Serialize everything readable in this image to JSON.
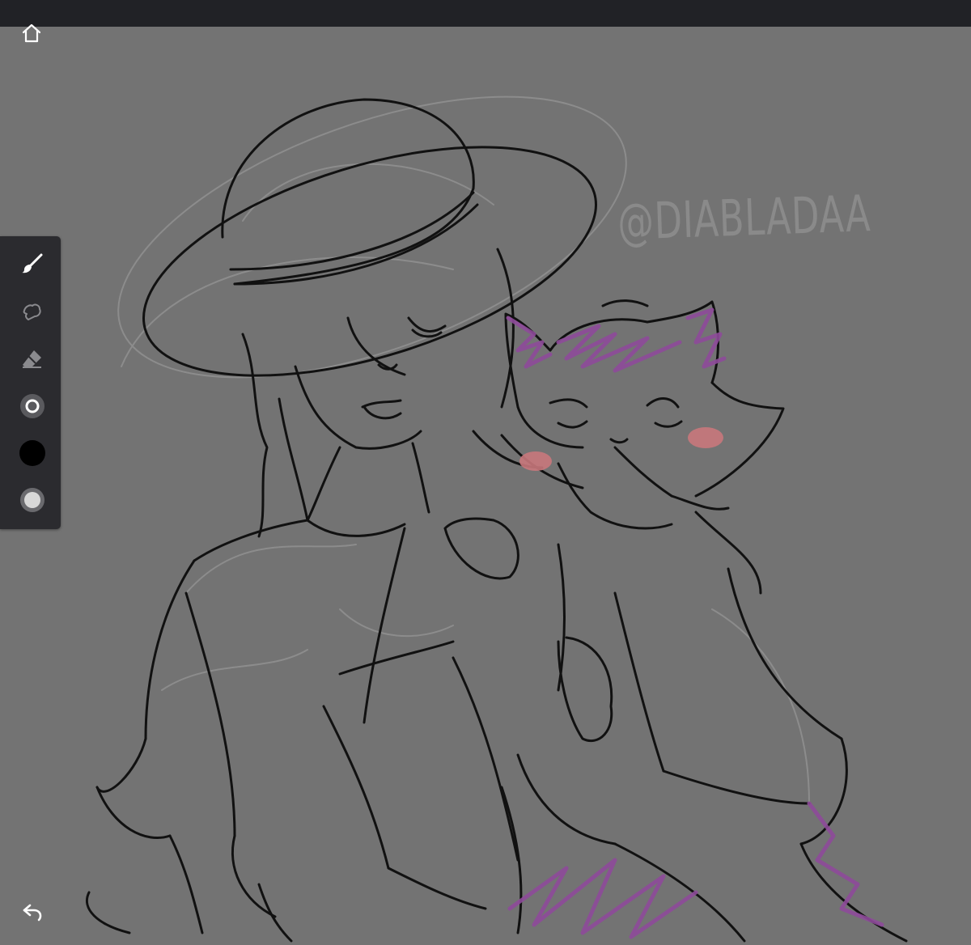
{
  "app": {
    "canvas_background": "#737373",
    "topbar_color": "#212226",
    "toolbar_color": "#2b2b2f"
  },
  "icons": {
    "home": "home-icon",
    "undo": "undo-icon"
  },
  "toolbar": {
    "tools": [
      {
        "name": "brush",
        "icon": "brush-icon",
        "active": true
      },
      {
        "name": "smudge",
        "icon": "smudge-icon",
        "active": false
      },
      {
        "name": "eraser",
        "icon": "eraser-icon",
        "active": false
      },
      {
        "name": "brush-size",
        "icon": "brush-size-icon",
        "active": false
      },
      {
        "name": "color",
        "icon": "color-swatch",
        "value": "#000000"
      },
      {
        "name": "opacity",
        "icon": "opacity-icon",
        "active": false
      }
    ]
  },
  "artwork": {
    "watermark": "@DIABLADAA",
    "accent_color": "#8e4a9a",
    "blush_color": "#c9787c"
  }
}
